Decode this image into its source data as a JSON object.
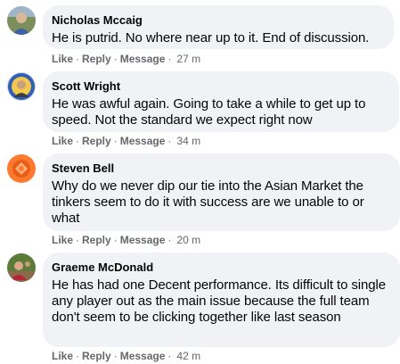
{
  "comments": [
    {
      "author": "Nicholas Mccaig",
      "text": "He is putrid. No where near up to it. End of discussion.",
      "like": "Like",
      "reply": "Reply",
      "message": "Message",
      "time": "27 m",
      "avatar_icon": "profile-photo-icon"
    },
    {
      "author": "Scott Wright",
      "text": "He was awful again. Going to take a while to get up to speed. Not the standard we expect right now",
      "like": "Like",
      "reply": "Reply",
      "message": "Message",
      "time": "34 m",
      "avatar_icon": "profile-photo-icon"
    },
    {
      "author": "Steven Bell",
      "text": "Why do we never dip our tie into the Asian Market the tinkers seem to do it with success are we unable to or what",
      "like": "Like",
      "reply": "Reply",
      "message": "Message",
      "time": "20 m",
      "avatar_icon": "profile-photo-icon"
    },
    {
      "author": "Graeme McDonald",
      "text": "He has had one Decent performance. Its difficult to single any player out as the main issue because the full team don't seem to be clicking together like last season",
      "like": "Like",
      "reply": "Reply",
      "message": "Message",
      "time": "42 m",
      "avatar_icon": "profile-photo-icon"
    }
  ],
  "separator": "·",
  "colors": {
    "bubble_bg": "#f0f2f5",
    "text": "#050505",
    "meta": "#65676b"
  }
}
